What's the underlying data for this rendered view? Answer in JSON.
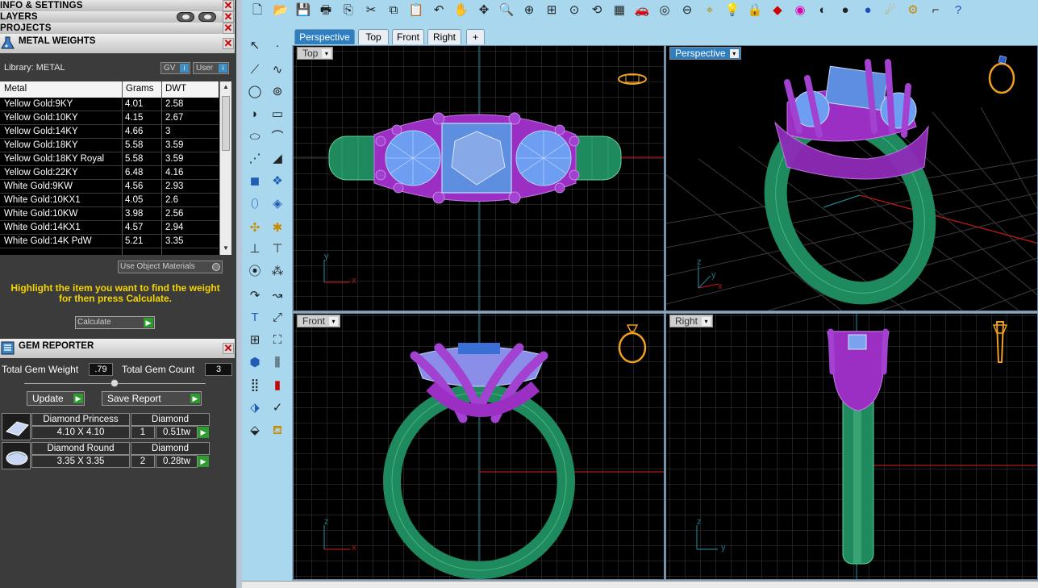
{
  "left": {
    "info_settings": "INFO & SETTINGS",
    "layers": "LAYERS",
    "projects": "PROJECTS",
    "close_glyph": "✕",
    "metal_weights": {
      "title": "METAL WEIGHTS",
      "library_label": "Library: METAL",
      "gv_label": "GV",
      "user_label": "User",
      "columns": [
        "Metal",
        "Grams",
        "DWT"
      ],
      "rows": [
        [
          "Yellow Gold:9KY",
          "4.01",
          "2.58"
        ],
        [
          "Yellow Gold:10KY",
          "4.15",
          "2.67"
        ],
        [
          "Yellow Gold:14KY",
          "4.66",
          "3"
        ],
        [
          "Yellow Gold:18KY",
          "5.58",
          "3.59"
        ],
        [
          "Yellow Gold:18KY Royal",
          "5.58",
          "3.59"
        ],
        [
          "Yellow Gold:22KY",
          "6.48",
          "4.16"
        ],
        [
          "White Gold:9KW",
          "4.56",
          "2.93"
        ],
        [
          "White Gold:10KX1",
          "4.05",
          "2.6"
        ],
        [
          "White Gold:10KW",
          "3.98",
          "2.56"
        ],
        [
          "White Gold:14KX1",
          "4.57",
          "2.94"
        ],
        [
          "White Gold:14K PdW",
          "5.21",
          "3.35"
        ]
      ],
      "use_object_materials": "Use Object Materials",
      "hint": "Highlight the item you want to find the weight for then press Calculate.",
      "calculate": "Calculate"
    },
    "gem_reporter": {
      "title": "GEM REPORTER",
      "total_weight_label": "Total Gem Weight",
      "total_weight": ".79",
      "total_count_label": "Total Gem Count",
      "total_count": "3",
      "update": "Update",
      "save_report": "Save Report",
      "gems": [
        {
          "name": "Diamond Princess",
          "material": "Diamond",
          "size": "4.10 X 4.10",
          "qty": "1",
          "weight": "0.51tw"
        },
        {
          "name": "Diamond Round",
          "material": "Diamond",
          "size": "3.35 X 3.35",
          "qty": "2",
          "weight": "0.28tw"
        }
      ]
    }
  },
  "tabs": [
    "Perspective",
    "Top",
    "Front",
    "Right"
  ],
  "tab_add": "+",
  "viewports": {
    "top": "Top",
    "perspective": "Perspective",
    "front": "Front",
    "right": "Right",
    "dropdown_glyph": "▾"
  },
  "axes": {
    "x": "x",
    "y": "y",
    "z": "z"
  },
  "colors": {
    "metal_green": "#1f8a5e",
    "prong_purple": "#9b2fc4",
    "gem_blue": "#6e9ef2",
    "grid": "#3e3e3e",
    "accent_blue": "#2d7fc1",
    "hint_yellow": "#f4d400"
  }
}
